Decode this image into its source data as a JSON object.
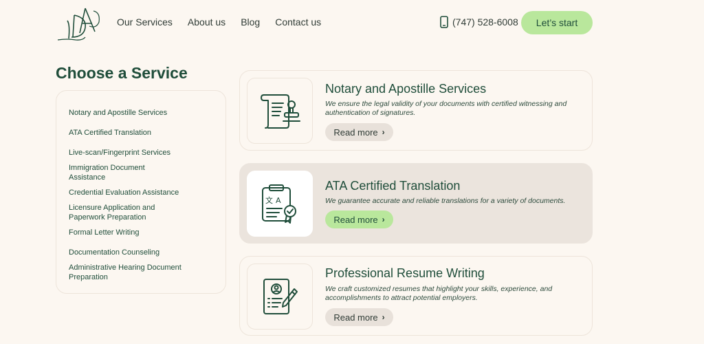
{
  "header": {
    "logo_alt": "DA",
    "nav": [
      "Our Services",
      "About us",
      "Blog",
      "Contact us"
    ],
    "phone": "(747) 528-6008",
    "cta_label": "Let’s start"
  },
  "sidebar": {
    "title": "Choose a Service",
    "items": [
      "Notary and Apostille Services",
      "ATA Certified Translation",
      "Live-scan/Fingerprint Services",
      "Immigration Document Assistance",
      "Credential Evaluation Assistance",
      "Licensure Application and Paperwork Preparation",
      "Formal Letter Writing",
      "Documentation Counseling",
      "Administrative Hearing Document Preparation"
    ]
  },
  "cards": [
    {
      "title": "Notary and Apostille Services",
      "description": "We ensure the legal validity of your documents with certified witnessing and authentication of signatures.",
      "more_label": "Read more",
      "icon": "scroll-stamp-icon"
    },
    {
      "title": "ATA Certified Translation",
      "description": "We guarantee accurate and reliable translations for a variety of documents.",
      "more_label": "Read more",
      "icon": "clipboard-translation-badge-icon"
    },
    {
      "title": "Professional Resume Writing",
      "description": "We craft customized resumes that highlight your skills, experience, and accomplishments to attract potential employers.",
      "more_label": "Read more",
      "icon": "resume-pen-icon"
    }
  ],
  "colors": {
    "background": "#fcf7f1",
    "primary_green": "#1f4d3a",
    "accent_light_green": "#b9e79c",
    "active_card": "#ebe4dd"
  }
}
